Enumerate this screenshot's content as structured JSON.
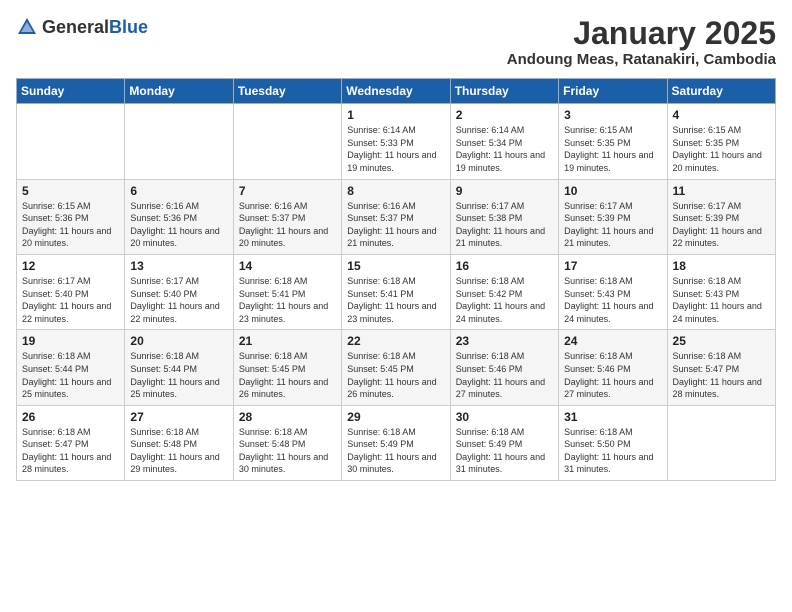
{
  "logo": {
    "general": "General",
    "blue": "Blue"
  },
  "header": {
    "month": "January 2025",
    "location": "Andoung Meas, Ratanakiri, Cambodia"
  },
  "weekdays": [
    "Sunday",
    "Monday",
    "Tuesday",
    "Wednesday",
    "Thursday",
    "Friday",
    "Saturday"
  ],
  "weeks": [
    [
      {
        "day": "",
        "sunrise": "",
        "sunset": "",
        "daylight": ""
      },
      {
        "day": "",
        "sunrise": "",
        "sunset": "",
        "daylight": ""
      },
      {
        "day": "",
        "sunrise": "",
        "sunset": "",
        "daylight": ""
      },
      {
        "day": "1",
        "sunrise": "Sunrise: 6:14 AM",
        "sunset": "Sunset: 5:33 PM",
        "daylight": "Daylight: 11 hours and 19 minutes."
      },
      {
        "day": "2",
        "sunrise": "Sunrise: 6:14 AM",
        "sunset": "Sunset: 5:34 PM",
        "daylight": "Daylight: 11 hours and 19 minutes."
      },
      {
        "day": "3",
        "sunrise": "Sunrise: 6:15 AM",
        "sunset": "Sunset: 5:35 PM",
        "daylight": "Daylight: 11 hours and 19 minutes."
      },
      {
        "day": "4",
        "sunrise": "Sunrise: 6:15 AM",
        "sunset": "Sunset: 5:35 PM",
        "daylight": "Daylight: 11 hours and 20 minutes."
      }
    ],
    [
      {
        "day": "5",
        "sunrise": "Sunrise: 6:15 AM",
        "sunset": "Sunset: 5:36 PM",
        "daylight": "Daylight: 11 hours and 20 minutes."
      },
      {
        "day": "6",
        "sunrise": "Sunrise: 6:16 AM",
        "sunset": "Sunset: 5:36 PM",
        "daylight": "Daylight: 11 hours and 20 minutes."
      },
      {
        "day": "7",
        "sunrise": "Sunrise: 6:16 AM",
        "sunset": "Sunset: 5:37 PM",
        "daylight": "Daylight: 11 hours and 20 minutes."
      },
      {
        "day": "8",
        "sunrise": "Sunrise: 6:16 AM",
        "sunset": "Sunset: 5:37 PM",
        "daylight": "Daylight: 11 hours and 21 minutes."
      },
      {
        "day": "9",
        "sunrise": "Sunrise: 6:17 AM",
        "sunset": "Sunset: 5:38 PM",
        "daylight": "Daylight: 11 hours and 21 minutes."
      },
      {
        "day": "10",
        "sunrise": "Sunrise: 6:17 AM",
        "sunset": "Sunset: 5:39 PM",
        "daylight": "Daylight: 11 hours and 21 minutes."
      },
      {
        "day": "11",
        "sunrise": "Sunrise: 6:17 AM",
        "sunset": "Sunset: 5:39 PM",
        "daylight": "Daylight: 11 hours and 22 minutes."
      }
    ],
    [
      {
        "day": "12",
        "sunrise": "Sunrise: 6:17 AM",
        "sunset": "Sunset: 5:40 PM",
        "daylight": "Daylight: 11 hours and 22 minutes."
      },
      {
        "day": "13",
        "sunrise": "Sunrise: 6:17 AM",
        "sunset": "Sunset: 5:40 PM",
        "daylight": "Daylight: 11 hours and 22 minutes."
      },
      {
        "day": "14",
        "sunrise": "Sunrise: 6:18 AM",
        "sunset": "Sunset: 5:41 PM",
        "daylight": "Daylight: 11 hours and 23 minutes."
      },
      {
        "day": "15",
        "sunrise": "Sunrise: 6:18 AM",
        "sunset": "Sunset: 5:41 PM",
        "daylight": "Daylight: 11 hours and 23 minutes."
      },
      {
        "day": "16",
        "sunrise": "Sunrise: 6:18 AM",
        "sunset": "Sunset: 5:42 PM",
        "daylight": "Daylight: 11 hours and 24 minutes."
      },
      {
        "day": "17",
        "sunrise": "Sunrise: 6:18 AM",
        "sunset": "Sunset: 5:43 PM",
        "daylight": "Daylight: 11 hours and 24 minutes."
      },
      {
        "day": "18",
        "sunrise": "Sunrise: 6:18 AM",
        "sunset": "Sunset: 5:43 PM",
        "daylight": "Daylight: 11 hours and 24 minutes."
      }
    ],
    [
      {
        "day": "19",
        "sunrise": "Sunrise: 6:18 AM",
        "sunset": "Sunset: 5:44 PM",
        "daylight": "Daylight: 11 hours and 25 minutes."
      },
      {
        "day": "20",
        "sunrise": "Sunrise: 6:18 AM",
        "sunset": "Sunset: 5:44 PM",
        "daylight": "Daylight: 11 hours and 25 minutes."
      },
      {
        "day": "21",
        "sunrise": "Sunrise: 6:18 AM",
        "sunset": "Sunset: 5:45 PM",
        "daylight": "Daylight: 11 hours and 26 minutes."
      },
      {
        "day": "22",
        "sunrise": "Sunrise: 6:18 AM",
        "sunset": "Sunset: 5:45 PM",
        "daylight": "Daylight: 11 hours and 26 minutes."
      },
      {
        "day": "23",
        "sunrise": "Sunrise: 6:18 AM",
        "sunset": "Sunset: 5:46 PM",
        "daylight": "Daylight: 11 hours and 27 minutes."
      },
      {
        "day": "24",
        "sunrise": "Sunrise: 6:18 AM",
        "sunset": "Sunset: 5:46 PM",
        "daylight": "Daylight: 11 hours and 27 minutes."
      },
      {
        "day": "25",
        "sunrise": "Sunrise: 6:18 AM",
        "sunset": "Sunset: 5:47 PM",
        "daylight": "Daylight: 11 hours and 28 minutes."
      }
    ],
    [
      {
        "day": "26",
        "sunrise": "Sunrise: 6:18 AM",
        "sunset": "Sunset: 5:47 PM",
        "daylight": "Daylight: 11 hours and 28 minutes."
      },
      {
        "day": "27",
        "sunrise": "Sunrise: 6:18 AM",
        "sunset": "Sunset: 5:48 PM",
        "daylight": "Daylight: 11 hours and 29 minutes."
      },
      {
        "day": "28",
        "sunrise": "Sunrise: 6:18 AM",
        "sunset": "Sunset: 5:48 PM",
        "daylight": "Daylight: 11 hours and 30 minutes."
      },
      {
        "day": "29",
        "sunrise": "Sunrise: 6:18 AM",
        "sunset": "Sunset: 5:49 PM",
        "daylight": "Daylight: 11 hours and 30 minutes."
      },
      {
        "day": "30",
        "sunrise": "Sunrise: 6:18 AM",
        "sunset": "Sunset: 5:49 PM",
        "daylight": "Daylight: 11 hours and 31 minutes."
      },
      {
        "day": "31",
        "sunrise": "Sunrise: 6:18 AM",
        "sunset": "Sunset: 5:50 PM",
        "daylight": "Daylight: 11 hours and 31 minutes."
      },
      {
        "day": "",
        "sunrise": "",
        "sunset": "",
        "daylight": ""
      }
    ]
  ]
}
